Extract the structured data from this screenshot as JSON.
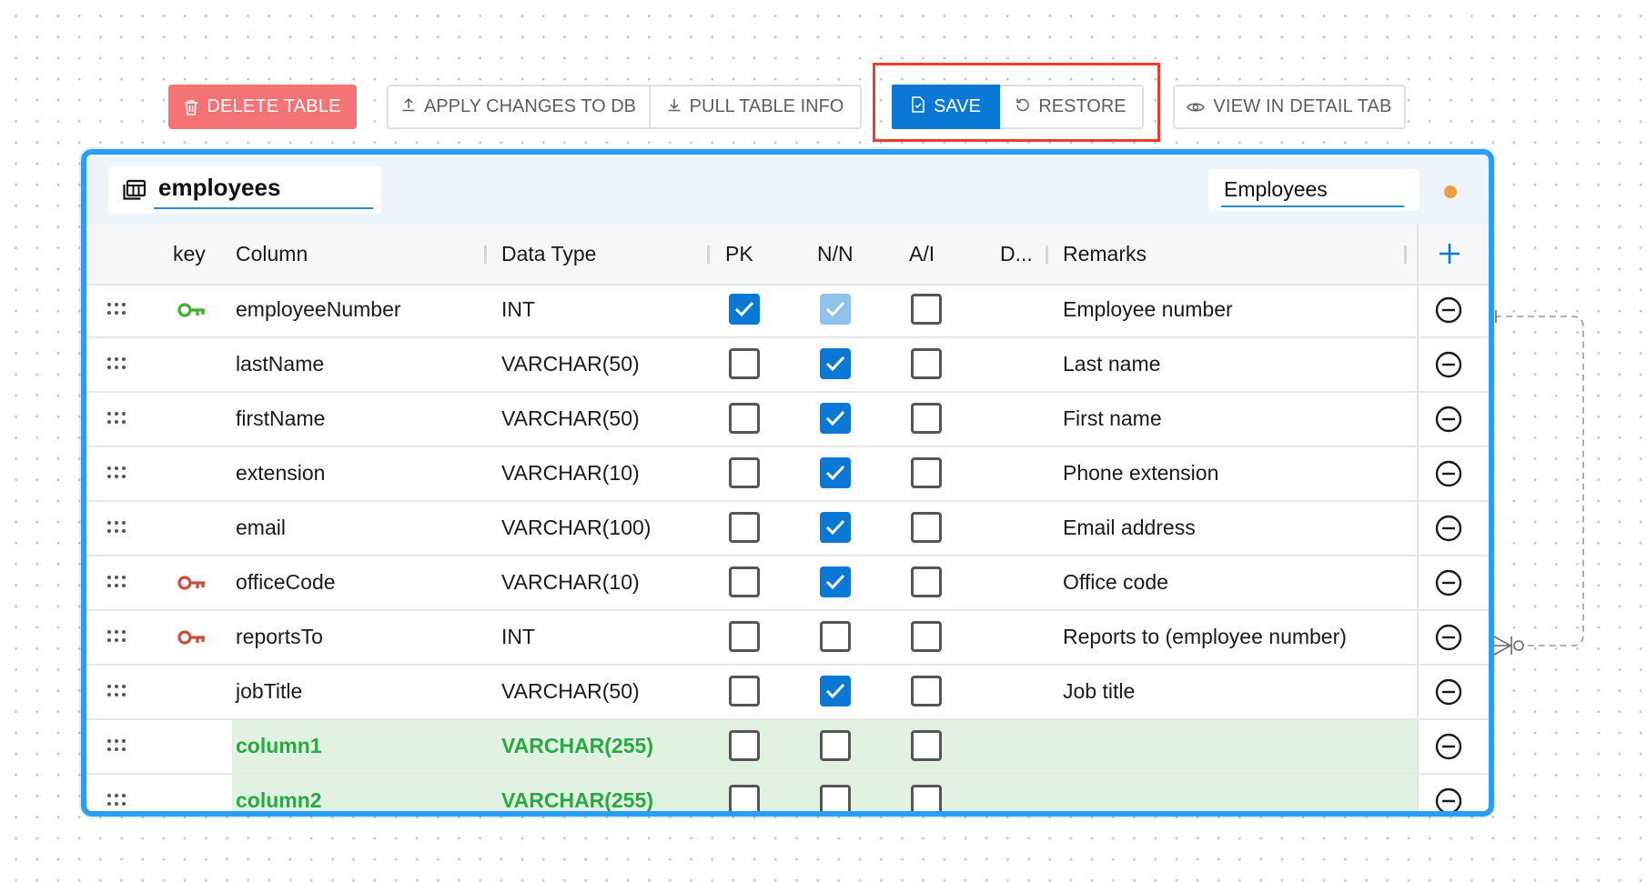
{
  "toolbar": {
    "delete_label": "DELETE TABLE",
    "apply_label": "APPLY CHANGES TO DB",
    "pull_label": "PULL TABLE INFO",
    "save_label": "SAVE",
    "restore_label": "RESTORE",
    "view_label": "VIEW IN DETAIL TAB",
    "delete_color": "#f47374",
    "save_color": "#0a78d4",
    "highlight_color": "#ee3b2b"
  },
  "table": {
    "name": "employees",
    "comment": "Employees",
    "accent_color": "#2a9df4",
    "status_dot_color": "#f09c3c"
  },
  "columns_header": {
    "key": "key",
    "column": "Column",
    "data_type": "Data Type",
    "pk": "PK",
    "nn": "N/N",
    "ai": "A/I",
    "default": "D...",
    "remarks": "Remarks"
  },
  "rows": [
    {
      "key": "primary",
      "name": "employeeNumber",
      "type": "INT",
      "pk": true,
      "nn": true,
      "nn_disabled": true,
      "ai": false,
      "remarks": "Employee number",
      "new": false
    },
    {
      "key": "",
      "name": "lastName",
      "type": "VARCHAR(50)",
      "pk": false,
      "nn": true,
      "nn_disabled": false,
      "ai": false,
      "remarks": "Last name",
      "new": false
    },
    {
      "key": "",
      "name": "firstName",
      "type": "VARCHAR(50)",
      "pk": false,
      "nn": true,
      "nn_disabled": false,
      "ai": false,
      "remarks": "First name",
      "new": false
    },
    {
      "key": "",
      "name": "extension",
      "type": "VARCHAR(10)",
      "pk": false,
      "nn": true,
      "nn_disabled": false,
      "ai": false,
      "remarks": "Phone extension",
      "new": false
    },
    {
      "key": "",
      "name": "email",
      "type": "VARCHAR(100)",
      "pk": false,
      "nn": true,
      "nn_disabled": false,
      "ai": false,
      "remarks": "Email address",
      "new": false
    },
    {
      "key": "foreign",
      "name": "officeCode",
      "type": "VARCHAR(10)",
      "pk": false,
      "nn": true,
      "nn_disabled": false,
      "ai": false,
      "remarks": "Office code",
      "new": false
    },
    {
      "key": "foreign",
      "name": "reportsTo",
      "type": "INT",
      "pk": false,
      "nn": false,
      "nn_disabled": false,
      "ai": false,
      "remarks": "Reports to (employee number)",
      "new": false
    },
    {
      "key": "",
      "name": "jobTitle",
      "type": "VARCHAR(50)",
      "pk": false,
      "nn": true,
      "nn_disabled": false,
      "ai": false,
      "remarks": "Job title",
      "new": false
    },
    {
      "key": "",
      "name": "column1",
      "type": "VARCHAR(255)",
      "pk": false,
      "nn": false,
      "nn_disabled": false,
      "ai": false,
      "remarks": "",
      "new": true
    },
    {
      "key": "",
      "name": "column2",
      "type": "VARCHAR(255)",
      "pk": false,
      "nn": false,
      "nn_disabled": false,
      "ai": false,
      "remarks": "",
      "new": true
    }
  ],
  "colors": {
    "primary_key": "#3fb12f",
    "foreign_key": "#c8503a",
    "new_row_bg": "#e1f2e3",
    "new_row_text": "#2aa844"
  },
  "icons": {
    "delete": "trash-icon",
    "apply": "upload-icon",
    "pull": "download-icon",
    "save": "save-file-icon",
    "restore": "undo-icon",
    "view": "eye-icon",
    "table": "table-icon",
    "add": "plus-icon",
    "remove": "minus-circle-icon",
    "drag": "drag-handle-icon",
    "key": "key-icon"
  }
}
